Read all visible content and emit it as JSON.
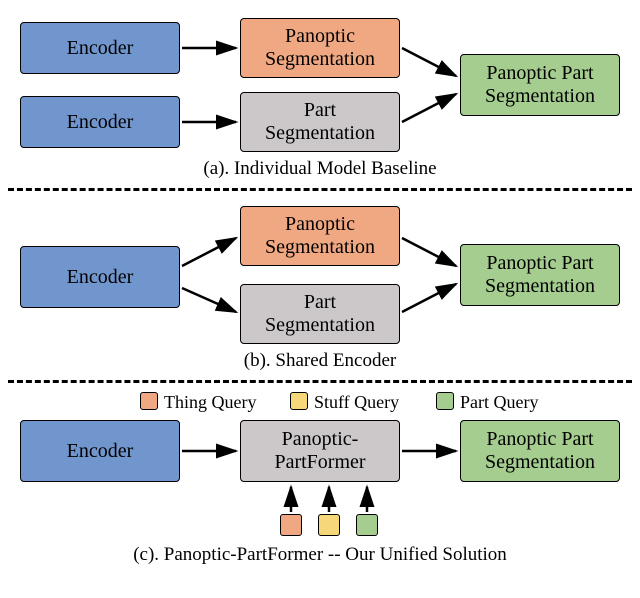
{
  "panelA": {
    "caption": "(a). Individual Model Baseline",
    "encoder1": "Encoder",
    "encoder2": "Encoder",
    "panoptic": "Panoptic\nSegmentation",
    "part": "Part\nSegmentation",
    "result": "Panoptic Part\nSegmentation"
  },
  "panelB": {
    "caption": "(b). Shared Encoder",
    "encoder": "Encoder",
    "panoptic": "Panoptic\nSegmentation",
    "part": "Part\nSegmentation",
    "result": "Panoptic Part\nSegmentation"
  },
  "panelC": {
    "caption": "(c). Panoptic-PartFormer -- Our Unified Solution",
    "encoder": "Encoder",
    "partformer": "Panoptic-\nPartFormer",
    "result": "Panoptic Part\nSegmentation",
    "legend": {
      "thing": "Thing Query",
      "stuff": "Stuff Query",
      "part": "Part Query"
    }
  }
}
